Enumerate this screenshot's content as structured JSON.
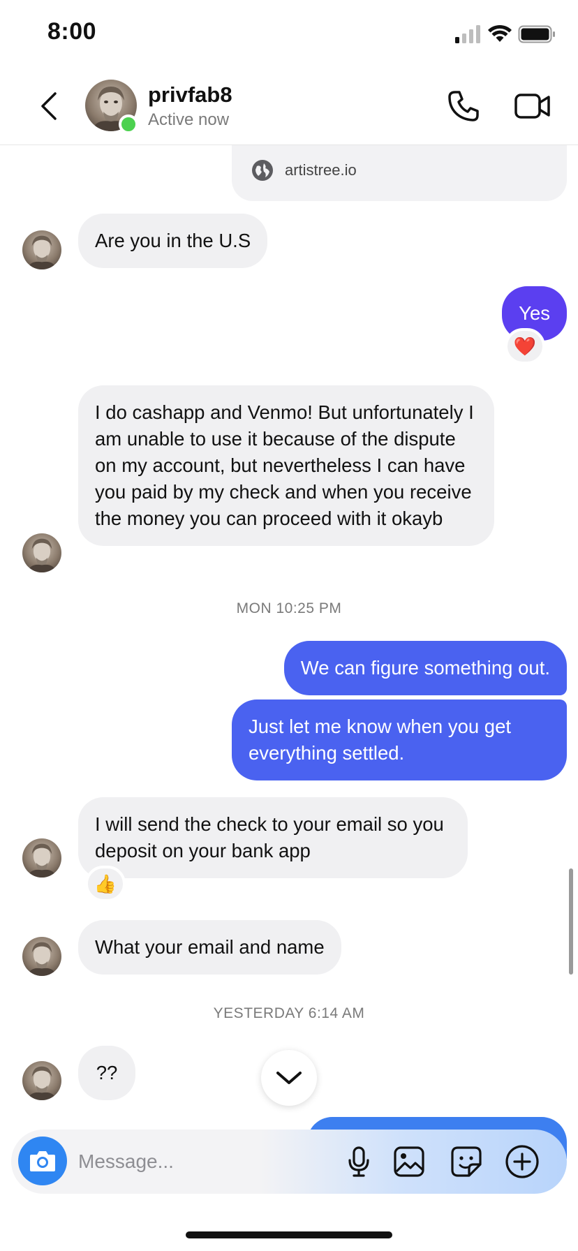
{
  "status_bar": {
    "time": "8:00"
  },
  "header": {
    "name": "privfab8",
    "status": "Active now"
  },
  "link_preview": {
    "domain": "artistree.io"
  },
  "messages": {
    "m1": "Are you in the U.S",
    "m2": "Yes",
    "m2_reaction": "❤️",
    "m3": "I do cashapp and Venmo! But unfortunately I am unable to use it because of the dispute on my account, but nevertheless I can have you paid by my check and when you receive the money you can proceed with it okayb",
    "ts1": "MON 10:25 PM",
    "m4": "We can figure something out.",
    "m5": "Just let me know when you get everything settled.",
    "m6": "I will send the check to your email so you deposit on your bank app",
    "m6_reaction": "👍",
    "m7": "What your email and name",
    "ts2": "YESTERDAY 6:14 AM",
    "m8": "??"
  },
  "composer": {
    "placeholder": "Message..."
  },
  "colors": {
    "outgoing_purple": "#5b3ff0",
    "outgoing_blue": "#4a62f0",
    "incoming": "#f0f0f2",
    "online": "#4cd14f",
    "camera_button": "#2f86f2"
  },
  "icons": [
    "back-icon",
    "phone-icon",
    "video-camera-icon",
    "globe-icon",
    "camera-icon",
    "microphone-icon",
    "image-icon",
    "sticker-icon",
    "plus-icon",
    "chevron-down-icon"
  ]
}
